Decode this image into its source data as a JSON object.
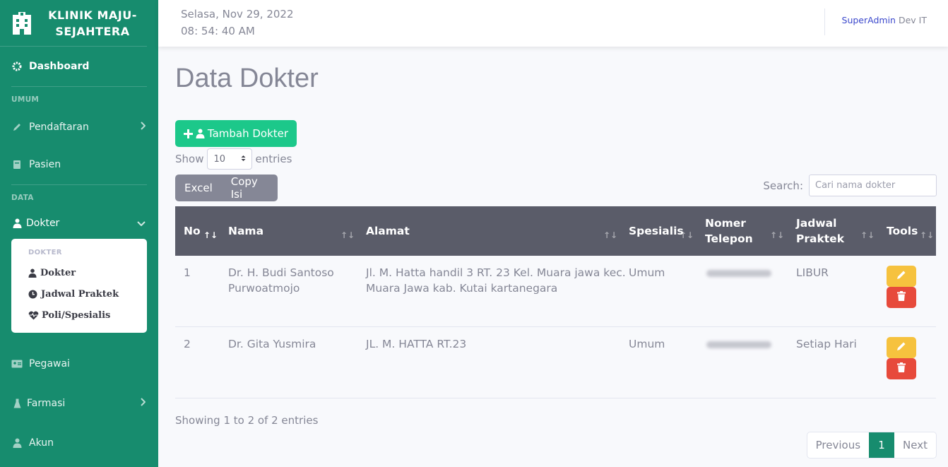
{
  "brand": {
    "name": "KLINIK MAJU-SEJAHTERA",
    "icon": "hospital-icon"
  },
  "sidebar": {
    "dashboard": "Dashboard",
    "heading_umum": "UMUM",
    "pendaftaran": "Pendaftaran",
    "pasien": "Pasien",
    "heading_data": "DATA",
    "dokter": "Dokter",
    "sub_heading": "DOKTER",
    "sub_dokter": "Dokter",
    "sub_jadwal": "Jadwal Praktek",
    "sub_poli": "Poli/Spesialis",
    "pegawai": "Pegawai",
    "farmasi": "Farmasi",
    "akun": "Akun"
  },
  "topbar": {
    "date": "Selasa, Nov 29, 2022",
    "time": "08: 54: 40 AM",
    "user_role": "SuperAdmin",
    "user_dept": "Dev IT"
  },
  "page": {
    "title": "Data Dokter",
    "add_button": "Tambah Dokter",
    "show_label": "Show",
    "entries_label": "entries",
    "page_length": "10",
    "excel_button": "Excel",
    "copy_button": "Copy Isi",
    "search_label": "Search:",
    "search_placeholder": "Cari nama dokter"
  },
  "table": {
    "headers": {
      "no": "No",
      "nama": "Nama",
      "alamat": "Alamat",
      "spesialis": "Spesialis",
      "telepon_1": "Nomer",
      "telepon_2": "Telepon",
      "jadwal_1": "Jadwal",
      "jadwal_2": "Praktek",
      "tools": "Tools"
    },
    "rows": [
      {
        "no": "1",
        "nama_1": "Dr. H. Budi Santoso",
        "nama_2": "Purwoatmojo",
        "alamat_1": "Jl. M. Hatta handil 3 RT. 23 Kel. Muara jawa kec.",
        "alamat_2": "Muara Jawa kab. Kutai kartanegara",
        "spesialis": "Umum",
        "jadwal": "LIBUR"
      },
      {
        "no": "2",
        "nama_1": "Dr. Gita Yusmira",
        "nama_2": "",
        "alamat_1": "JL. M. HATTA RT.23",
        "alamat_2": "",
        "spesialis": "Umum",
        "jadwal": "Setiap Hari"
      }
    ]
  },
  "footer": {
    "info": "Showing 1 to 2 of 2 entries",
    "previous": "Previous",
    "current_page": "1",
    "next": "Next"
  },
  "colors": {
    "sidebar": "#178c6e",
    "add_button": "#1cc88a",
    "table_header": "#5a5c69",
    "edit": "#f6c23e",
    "delete": "#e74a3b"
  }
}
